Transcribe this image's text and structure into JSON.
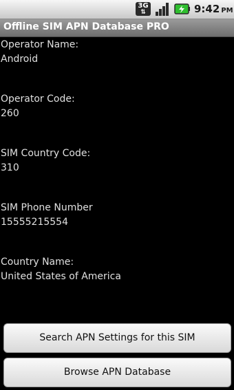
{
  "status_bar": {
    "network_icon": "3g-data-icon",
    "network_label": "3G",
    "network_arrows": "⇅",
    "signal_icon": "signal-strength-icon",
    "battery_icon": "battery-charging-icon",
    "time": "9:42",
    "ampm": "PM"
  },
  "app": {
    "title": "Offline SIM APN Database PRO"
  },
  "fields": [
    {
      "label": "Operator Name:",
      "value": "Android"
    },
    {
      "label": "Operator Code:",
      "value": "260"
    },
    {
      "label": "SIM Country Code:",
      "value": "310"
    },
    {
      "label": "SIM Phone Number",
      "value": "15555215554"
    },
    {
      "label": "Country Name:",
      "value": "United States of America"
    }
  ],
  "buttons": {
    "search_label": "Search APN Settings for this SIM",
    "browse_label": "Browse APN Database"
  },
  "colors": {
    "background": "#000000",
    "text": "#e0e0e0",
    "battery_accent": "#2fbf2f"
  }
}
